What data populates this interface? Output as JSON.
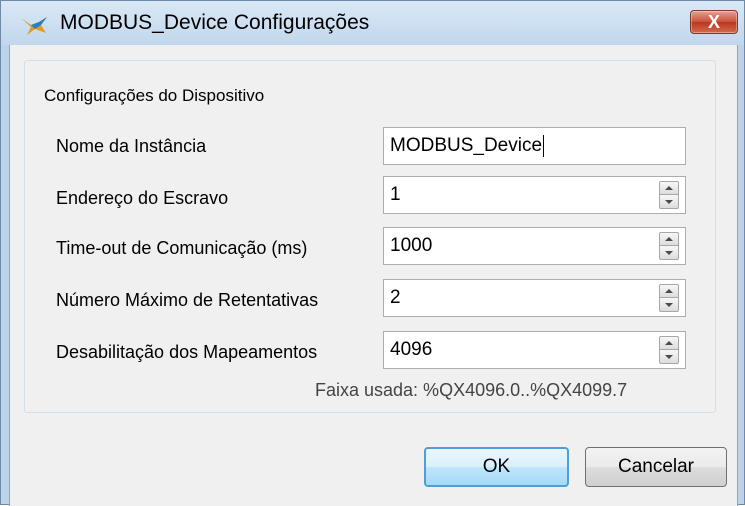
{
  "window": {
    "title": "MODBUS_Device Configurações",
    "close_symbol": "X",
    "app_icon": "bird-icon",
    "accent_color": "#4ca0d8"
  },
  "group": {
    "title": "Configurações do Dispositivo"
  },
  "fields": {
    "instance_name": {
      "label": "Nome da Instância",
      "value": "MODBUS_Device"
    },
    "slave_address": {
      "label": "Endereço do Escravo",
      "value": "1"
    },
    "timeout": {
      "label": "Time-out de Comunicação (ms)",
      "value": "1000"
    },
    "max_retries": {
      "label": "Número Máximo de Retentativas",
      "value": "2"
    },
    "mapping_disable": {
      "label": "Desabilitação dos Mapeamentos",
      "value": "4096"
    }
  },
  "range_info": "Faixa usada: %QX4096.0..%QX4099.7",
  "buttons": {
    "ok_label": "OK",
    "cancel_label": "Cancelar"
  }
}
